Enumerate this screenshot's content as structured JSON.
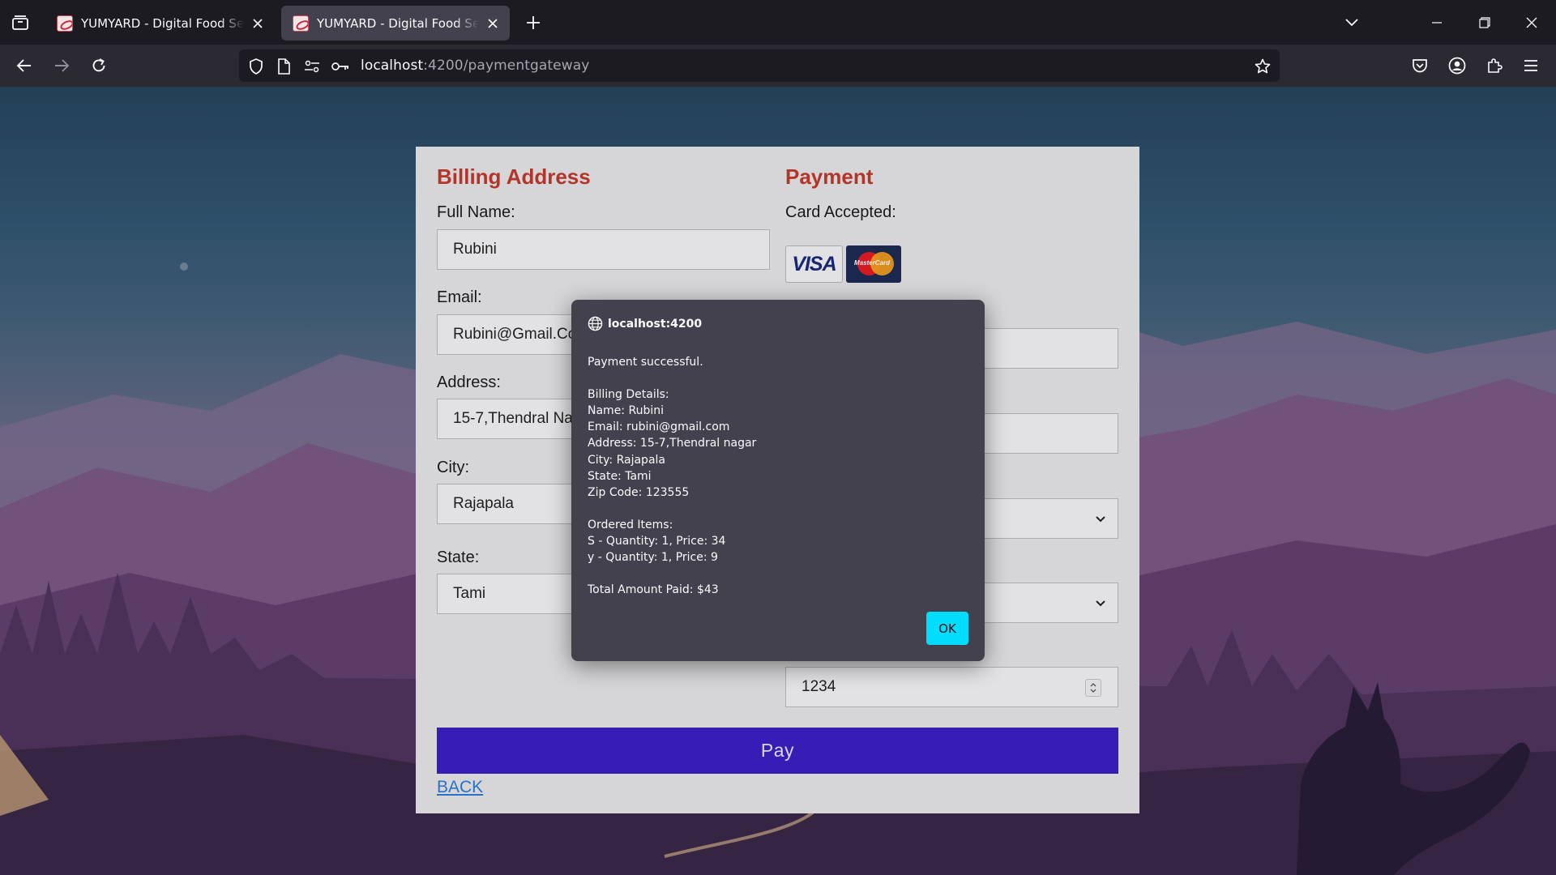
{
  "browser": {
    "tabs": [
      {
        "title": "YUMYARD - Digital Food Service",
        "active": false
      },
      {
        "title": "YUMYARD - Digital Food Service",
        "active": true
      }
    ],
    "url_host": "localhost",
    "url_path": ":4200/paymentgateway"
  },
  "billing": {
    "heading": "Billing Address",
    "full_name_label": "Full Name:",
    "full_name_value": "Rubini",
    "email_label": "Email:",
    "email_value": "Rubini@Gmail.Com",
    "address_label": "Address:",
    "address_value": "15-7,Thendral Nagar",
    "city_label": "City:",
    "city_value": "Rajapala",
    "state_label": "State:",
    "state_value": "Tami"
  },
  "payment": {
    "heading": "Payment",
    "cards_label": "Card Accepted:",
    "visa_text": "VISA",
    "mastercard_text": "MasterCard",
    "cvv_value": "1234"
  },
  "actions": {
    "pay_label": "Pay",
    "back_label": "BACK"
  },
  "dialog": {
    "origin": "localhost:4200",
    "message": "Payment successful.\n\nBilling Details:\nName: Rubini\nEmail: rubini@gmail.com\nAddress: 15-7,Thendral nagar\nCity: Rajapala\nState: Tami\nZip Code: 123555\n\nOrdered Items:\nS - Quantity: 1, Price: 34\ny - Quantity: 1, Price: 9\n\nTotal Amount Paid: $43",
    "ok_label": "OK"
  },
  "colors": {
    "heading_red": "#c0392b",
    "pay_button": "#3a1fc4",
    "ok_button": "#00ddff",
    "dialog_bg": "#42414d"
  }
}
